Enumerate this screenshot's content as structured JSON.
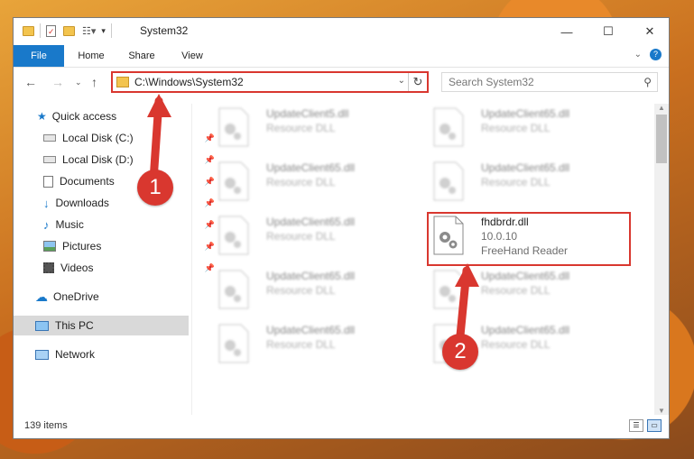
{
  "window": {
    "title": "System32",
    "tabs": [
      "File",
      "Home",
      "Share",
      "View"
    ]
  },
  "address": {
    "path": "C:\\Windows\\System32",
    "search_placeholder": "Search System32"
  },
  "sidebar": {
    "items": [
      {
        "label": "Quick access",
        "icon": "star-icon",
        "pinned": false
      },
      {
        "label": "Local Disk (C:)",
        "icon": "drive-icon",
        "pinned": true
      },
      {
        "label": "Local Disk (D:)",
        "icon": "drive-icon",
        "pinned": true
      },
      {
        "label": "Documents",
        "icon": "documents-icon",
        "pinned": true
      },
      {
        "label": "Downloads",
        "icon": "download-icon",
        "pinned": true
      },
      {
        "label": "Music",
        "icon": "music-icon",
        "pinned": true
      },
      {
        "label": "Pictures",
        "icon": "pictures-icon",
        "pinned": true
      },
      {
        "label": "Videos",
        "icon": "videos-icon",
        "pinned": true
      },
      {
        "label": "OneDrive",
        "icon": "cloud-icon",
        "pinned": false
      },
      {
        "label": "This PC",
        "icon": "computer-icon",
        "pinned": false,
        "selected": true
      },
      {
        "label": "Network",
        "icon": "network-icon",
        "pinned": false
      }
    ]
  },
  "files": [
    {
      "name": "UpdateClient5.dll",
      "type": "Resource DLL",
      "blurred": true
    },
    {
      "name": "UpdateClient65.dll",
      "type": "Resource DLL",
      "blurred": true
    },
    {
      "name": "UpdateClient65.dll",
      "type": "Resource DLL",
      "blurred": true
    },
    {
      "name": "UpdateClient65.dll",
      "type": "Resource DLL",
      "blurred": true
    },
    {
      "name": "UpdateClient65.dll",
      "type": "Resource DLL",
      "blurred": true
    },
    {
      "name": "fhdbrdr.dll",
      "version": "10.0.10",
      "description": "FreeHand Reader",
      "blurred": false,
      "highlighted": true
    },
    {
      "name": "UpdateClient65.dll",
      "type": "Resource DLL",
      "blurred": true
    },
    {
      "name": "UpdateClient65.dll",
      "type": "Resource DLL",
      "blurred": true
    },
    {
      "name": "UpdateClient65.dll",
      "type": "Resource DLL",
      "blurred": true
    },
    {
      "name": "UpdateClient65.dll",
      "type": "Resource DLL",
      "blurred": true
    }
  ],
  "status": {
    "item_count": "139 items"
  },
  "annotations": {
    "step1": "1",
    "step2": "2",
    "color": "#d9372f"
  }
}
